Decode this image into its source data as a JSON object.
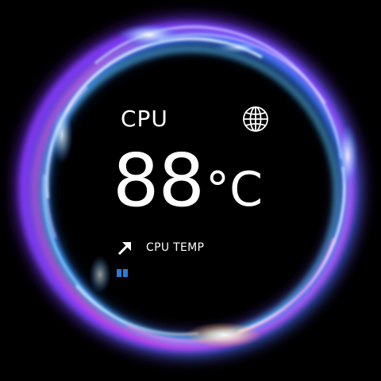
{
  "widget": {
    "title": "CPU",
    "temperature": {
      "value": "88",
      "unit": "°C"
    },
    "sensor_label": "CPU TEMP"
  },
  "icons": {
    "header_icon": "globe-icon",
    "sensor_icon": "arrow-up-right-icon",
    "indicator_icon": "page-indicator-icon"
  },
  "colors": {
    "background": "#000000",
    "text": "#ffffff",
    "ring_core": "#ffffff",
    "ring_blue": "#2f7bff",
    "ring_cyan": "#5fd0ff",
    "ring_violet": "#8a3cff",
    "ring_magenta": "#ff4fd8",
    "ring_orange": "#ffb25a",
    "indicator": "#2a7bd8"
  }
}
